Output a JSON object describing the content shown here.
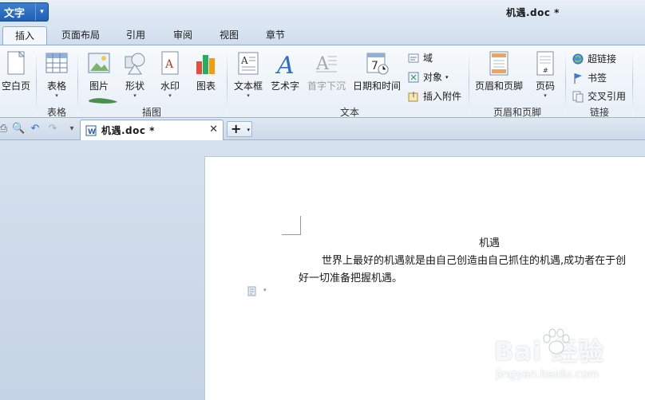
{
  "titlebar": {
    "app_label": "文字",
    "app_arrow": "▾",
    "doc_title": "机遇.doc *"
  },
  "tabs": [
    {
      "label": "插入",
      "active": true
    },
    {
      "label": "页面布局",
      "active": false
    },
    {
      "label": "引用",
      "active": false
    },
    {
      "label": "审阅",
      "active": false
    },
    {
      "label": "视图",
      "active": false
    },
    {
      "label": "章节",
      "active": false
    }
  ],
  "ribbon": {
    "blank_page": "空白页",
    "table": "表格",
    "picture": "图片",
    "shape": "形状",
    "watermark": "水印",
    "chart": "图表",
    "textbox": "文本框",
    "wordart": "艺术字",
    "dropcap": "首字下沉",
    "datetime": "日期和时间",
    "field": "域",
    "object": "对象",
    "attachment": "插入附件",
    "header_footer": "页眉和页脚",
    "page_number": "页码",
    "hyperlink": "超链接",
    "bookmark": "书签",
    "cross_ref": "交叉引用",
    "dropdown_glyph": "▾",
    "groups": {
      "table": "表格",
      "illustration": "插图",
      "text": "文本",
      "header_footer": "页眉和页脚",
      "link": "链接"
    }
  },
  "doc_tab": {
    "title": "机遇.doc *",
    "close": "✕",
    "new_tab": "+",
    "new_tab_arrow": "▾"
  },
  "document": {
    "heading": "机遇",
    "line1": "世界上最好的机遇就是由自己创造由自己抓住的机遇,成功者在于创",
    "line2": "好一切准备把握机遇。"
  },
  "watermark": {
    "text": "Bai  经验",
    "url": "jingyan.baidu.com"
  },
  "colors": {
    "accent": "#1f5fb4",
    "ribbon_bg": "#eef3f9",
    "workspace_bg": "#cfdbe8",
    "green_mark": "#2e7d32"
  }
}
